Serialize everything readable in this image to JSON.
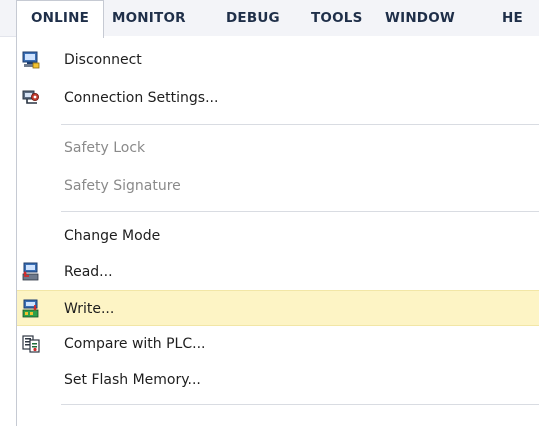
{
  "menubar": {
    "items": [
      {
        "label": "ONLINE"
      },
      {
        "label": "MONITOR"
      },
      {
        "label": "DEBUG"
      },
      {
        "label": "TOOLS"
      },
      {
        "label": "WINDOW"
      },
      {
        "label": "HE"
      }
    ],
    "active": "ONLINE"
  },
  "dropdown": {
    "items": [
      {
        "label": "Disconnect",
        "icon": "disconnect-icon",
        "enabled": true
      },
      {
        "label": "Connection Settings...",
        "icon": "connection-settings-icon",
        "enabled": true
      },
      {
        "label": "Safety Lock",
        "enabled": false
      },
      {
        "label": "Safety Signature",
        "enabled": false
      },
      {
        "label": "Change Mode",
        "has_submenu": true,
        "enabled": true
      },
      {
        "label": "Read...",
        "icon": "read-icon",
        "enabled": true
      },
      {
        "label": "Write...",
        "icon": "write-icon",
        "enabled": true,
        "highlighted": true
      },
      {
        "label": "Compare with PLC...",
        "icon": "compare-icon",
        "enabled": true
      },
      {
        "label": "Set Flash Memory...",
        "enabled": true
      }
    ]
  },
  "colors": {
    "menubar_bg": "#f3f4f8",
    "menubar_text": "#1f2f49",
    "highlight": "#fdf4c5",
    "disabled_text": "#8a8a8a"
  }
}
